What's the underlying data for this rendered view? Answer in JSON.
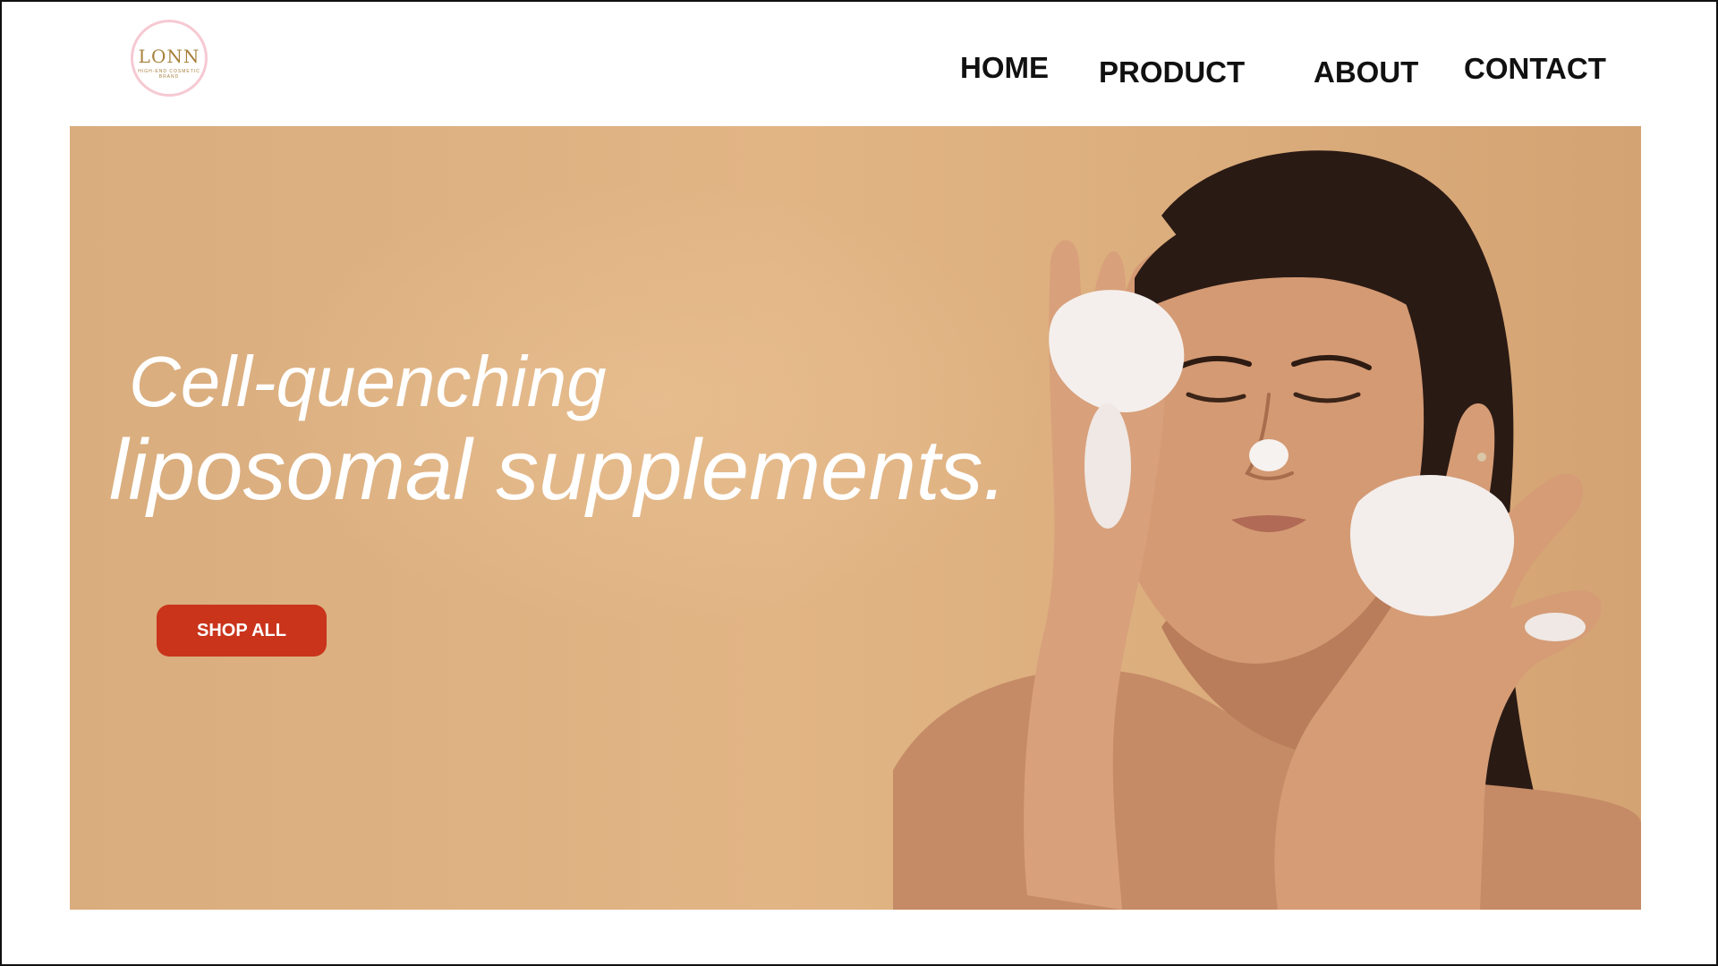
{
  "brand": {
    "logo_mark": "LONN",
    "logo_sub": "HIGH-END COSMETIC BRAND",
    "accent_pink": "#f6c9d2",
    "gold": "#a7813c"
  },
  "nav": {
    "home": "HOME",
    "product": "PRODUCT",
    "about": "ABOUT",
    "contact": "CONTACT"
  },
  "hero": {
    "line1": "Cell-quenching",
    "line2": "liposomal supplements.",
    "button_label": "SHOP ALL",
    "button_color": "#c9341b",
    "background_color": "#dfb283",
    "image": "woman-washing-face-with-foam"
  }
}
